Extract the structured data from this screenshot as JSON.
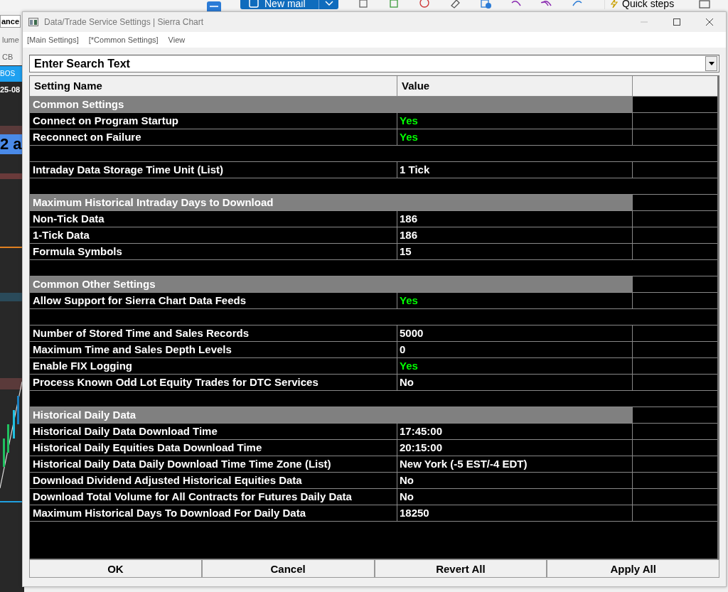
{
  "background": {
    "ribbon": {
      "new_mail": "New mail",
      "quick_steps": "Quick steps"
    },
    "chart_window": {
      "tab": "ance",
      "labels": [
        "lume",
        "CB"
      ],
      "banner": "BOS",
      "date": "25-08",
      "tag": "2 a"
    }
  },
  "window": {
    "title": "Data/Trade Service Settings | Sierra Chart"
  },
  "menu": [
    {
      "label": "[Main Settings]"
    },
    {
      "label": "[*Common Settings]"
    },
    {
      "label": "View"
    }
  ],
  "search": {
    "placeholder": "Enter Search Text"
  },
  "table": {
    "columns": [
      "Setting Name",
      "Value"
    ],
    "rows": [
      {
        "kind": "section",
        "name": "Common Settings"
      },
      {
        "kind": "setting",
        "name": "Connect on Program Startup",
        "value": "Yes",
        "color": "#00ff00"
      },
      {
        "kind": "setting",
        "name": "Reconnect on Failure",
        "value": "Yes",
        "color": "#00ff00"
      },
      {
        "kind": "blank"
      },
      {
        "kind": "setting",
        "name": "Intraday Data Storage Time Unit (List)",
        "value": "1 Tick",
        "color": "#ffffff"
      },
      {
        "kind": "blank"
      },
      {
        "kind": "section",
        "name": "Maximum Historical Intraday Days to Download"
      },
      {
        "kind": "setting",
        "name": "Non-Tick Data",
        "value": "186",
        "color": "#ffffff"
      },
      {
        "kind": "setting",
        "name": "1-Tick Data",
        "value": "186",
        "color": "#ffffff"
      },
      {
        "kind": "setting",
        "name": "Formula Symbols",
        "value": "15",
        "color": "#ffffff"
      },
      {
        "kind": "blank"
      },
      {
        "kind": "section",
        "name": "Common Other Settings"
      },
      {
        "kind": "setting",
        "name": "Allow Support for Sierra Chart Data Feeds",
        "value": "Yes",
        "color": "#00ff00"
      },
      {
        "kind": "blank"
      },
      {
        "kind": "setting",
        "name": "Number of Stored Time and Sales Records",
        "value": "5000",
        "color": "#ffffff"
      },
      {
        "kind": "setting",
        "name": "Maximum Time and Sales Depth Levels",
        "value": "0",
        "color": "#ffffff"
      },
      {
        "kind": "setting",
        "name": "Enable FIX Logging",
        "value": "Yes",
        "color": "#00ff00"
      },
      {
        "kind": "setting",
        "name": "Process Known Odd Lot Equity Trades for DTC Services",
        "value": "No",
        "color": "#ffffff"
      },
      {
        "kind": "blank"
      },
      {
        "kind": "section",
        "name": "Historical Daily Data"
      },
      {
        "kind": "setting",
        "name": "Historical Daily Data Download Time",
        "value": "17:45:00",
        "color": "#ffffff"
      },
      {
        "kind": "setting",
        "name": "Historical Daily Equities Data Download Time",
        "value": "20:15:00",
        "color": "#ffffff"
      },
      {
        "kind": "setting",
        "name": "Historical Daily Data Daily Download Time Time Zone (List)",
        "value": "New York (-5 EST/-4 EDT)",
        "color": "#ffffff"
      },
      {
        "kind": "setting",
        "name": "Download Dividend Adjusted Historical Equities Data",
        "value": "No",
        "color": "#ffffff"
      },
      {
        "kind": "setting",
        "name": "Download Total Volume for All Contracts for Futures Daily Data",
        "value": "No",
        "color": "#ffffff"
      },
      {
        "kind": "setting",
        "name": "Maximum Historical Days To Download For Daily Data",
        "value": "18250",
        "color": "#ffffff"
      }
    ]
  },
  "buttons": [
    {
      "label": "OK"
    },
    {
      "label": "Cancel"
    },
    {
      "label": "Revert All"
    },
    {
      "label": "Apply All"
    }
  ]
}
